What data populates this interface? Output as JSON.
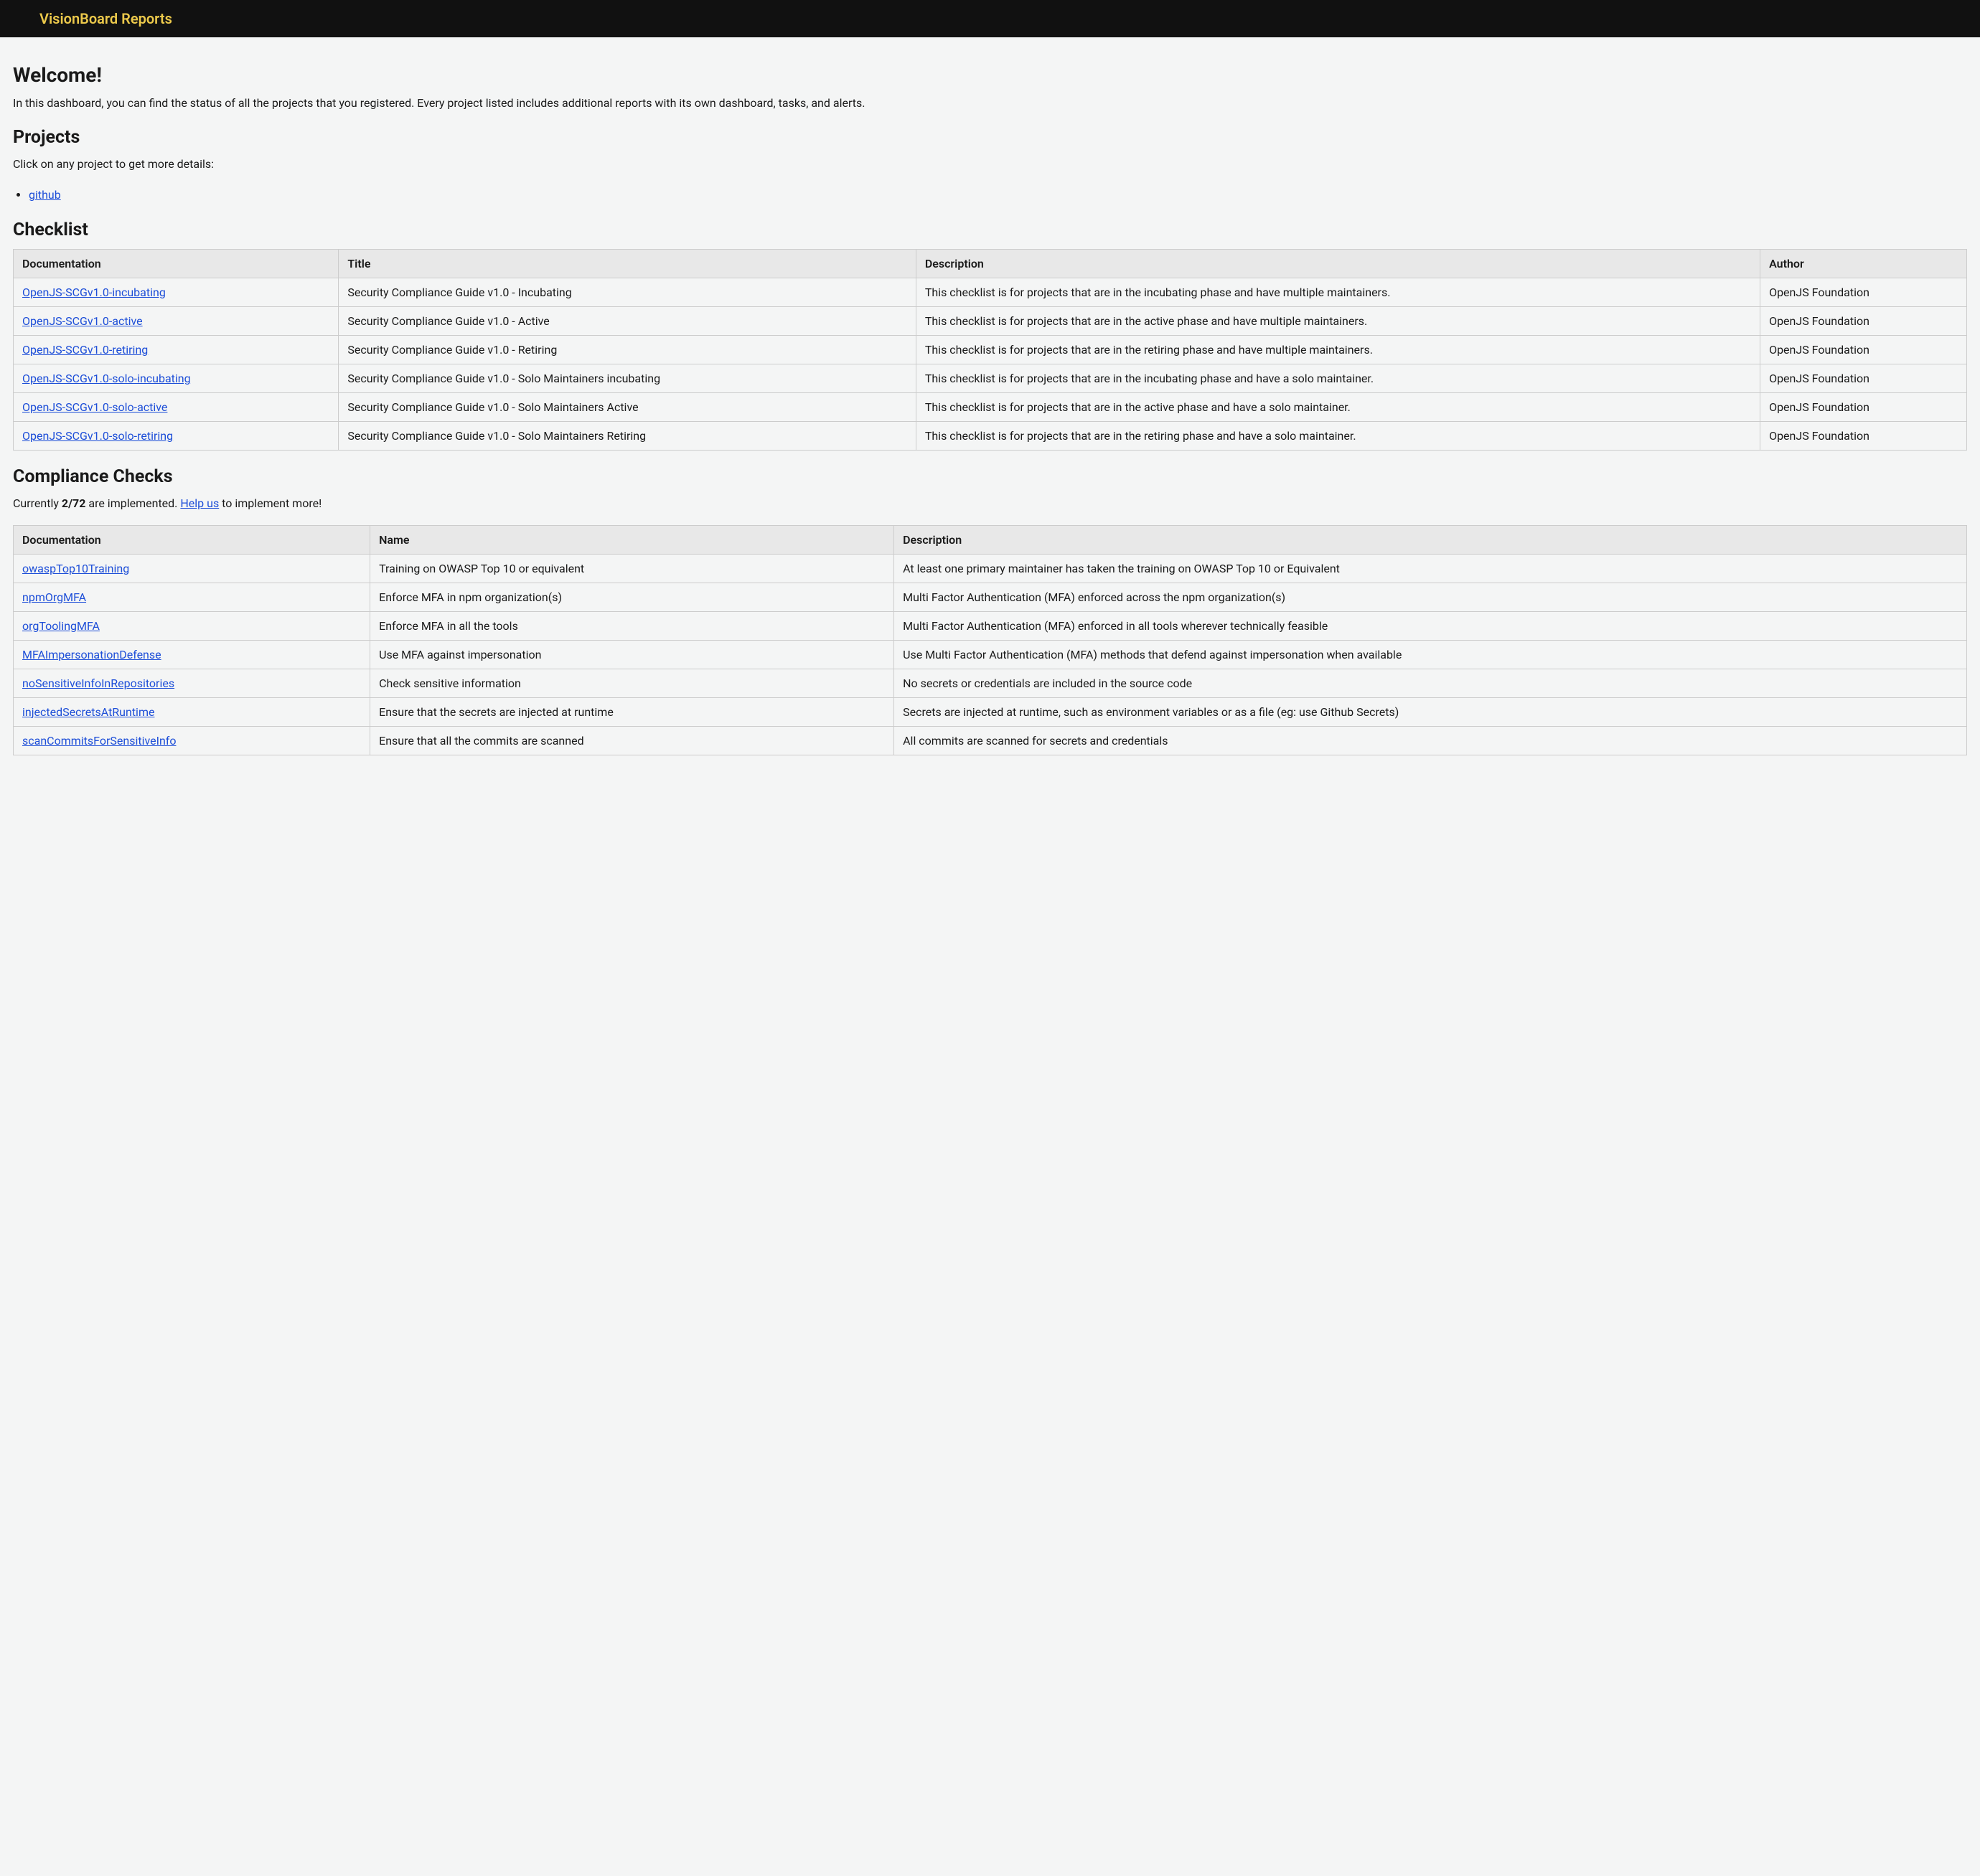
{
  "header": {
    "brand": "VisionBoard Reports"
  },
  "welcome": {
    "heading": "Welcome!",
    "intro": "In this dashboard, you can find the status of all the projects that you registered. Every project listed includes additional reports with its own dashboard, tasks, and alerts."
  },
  "projects": {
    "heading": "Projects",
    "intro": "Click on any project to get more details:",
    "items": [
      {
        "label": "github"
      }
    ]
  },
  "checklist": {
    "heading": "Checklist",
    "columns": {
      "documentation": "Documentation",
      "title": "Title",
      "description": "Description",
      "author": "Author"
    },
    "rows": [
      {
        "doc": "OpenJS-SCGv1.0-incubating",
        "title": "Security Compliance Guide v1.0 - Incubating",
        "description": "This checklist is for projects that are in the incubating phase and have multiple maintainers.",
        "author": "OpenJS Foundation"
      },
      {
        "doc": "OpenJS-SCGv1.0-active",
        "title": "Security Compliance Guide v1.0 - Active",
        "description": "This checklist is for projects that are in the active phase and have multiple maintainers.",
        "author": "OpenJS Foundation"
      },
      {
        "doc": "OpenJS-SCGv1.0-retiring",
        "title": "Security Compliance Guide v1.0 - Retiring",
        "description": "This checklist is for projects that are in the retiring phase and have multiple maintainers.",
        "author": "OpenJS Foundation"
      },
      {
        "doc": "OpenJS-SCGv1.0-solo-incubating",
        "title": "Security Compliance Guide v1.0 - Solo Maintainers incubating",
        "description": "This checklist is for projects that are in the incubating phase and have a solo maintainer.",
        "author": "OpenJS Foundation"
      },
      {
        "doc": "OpenJS-SCGv1.0-solo-active",
        "title": "Security Compliance Guide v1.0 - Solo Maintainers Active",
        "description": "This checklist is for projects that are in the active phase and have a solo maintainer.",
        "author": "OpenJS Foundation"
      },
      {
        "doc": "OpenJS-SCGv1.0-solo-retiring",
        "title": "Security Compliance Guide v1.0 - Solo Maintainers Retiring",
        "description": "This checklist is for projects that are in the retiring phase and have a solo maintainer.",
        "author": "OpenJS Foundation"
      }
    ]
  },
  "compliance": {
    "heading": "Compliance Checks",
    "status_prefix": "Currently ",
    "status_count": "2/72",
    "status_mid": " are implemented. ",
    "help_label": "Help us",
    "status_suffix": " to implement more!",
    "columns": {
      "documentation": "Documentation",
      "name": "Name",
      "description": "Description"
    },
    "rows": [
      {
        "doc": "owaspTop10Training",
        "name": "Training on OWASP Top 10 or equivalent",
        "description": "At least one primary maintainer has taken the training on OWASP Top 10 or Equivalent"
      },
      {
        "doc": "npmOrgMFA",
        "name": "Enforce MFA in npm organization(s)",
        "description": "Multi Factor Authentication (MFA) enforced across the npm organization(s)"
      },
      {
        "doc": "orgToolingMFA",
        "name": "Enforce MFA in all the tools",
        "description": "Multi Factor Authentication (MFA) enforced in all tools wherever technically feasible"
      },
      {
        "doc": "MFAImpersonationDefense",
        "name": "Use MFA against impersonation",
        "description": "Use Multi Factor Authentication (MFA) methods that defend against impersonation when available"
      },
      {
        "doc": "noSensitiveInfoInRepositories",
        "name": "Check sensitive information",
        "description": "No secrets or credentials are included in the source code"
      },
      {
        "doc": "injectedSecretsAtRuntime",
        "name": "Ensure that the secrets are injected at runtime",
        "description": "Secrets are injected at runtime, such as environment variables or as a file (eg: use Github Secrets)"
      },
      {
        "doc": "scanCommitsForSensitiveInfo",
        "name": "Ensure that all the commits are scanned",
        "description": "All commits are scanned for secrets and credentials"
      }
    ]
  }
}
